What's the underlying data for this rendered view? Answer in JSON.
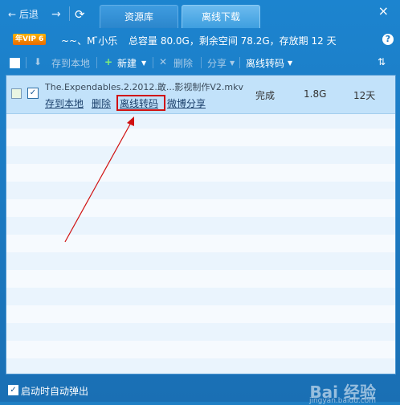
{
  "nav": {
    "back_label": "← 后退",
    "forward_label": "→",
    "refresh_label": "⟳"
  },
  "tabs": [
    {
      "label": "资源库"
    },
    {
      "label": "离线下载"
    }
  ],
  "info": {
    "vip_badge": "年VIP 6",
    "username": "~~、M ̄小乐",
    "storage_text": "总容量 80.0G，剩余空间 78.2G，存放期 12 天"
  },
  "toolbar": {
    "save_local": "存到本地",
    "new": "新建",
    "delete": "删除",
    "share": "分享",
    "transcode": "离线转码"
  },
  "list": {
    "rows": [
      {
        "filename": "The.Expendables.2.2012.敢...影视制作V2.mkv",
        "actions": [
          "存到本地",
          "删除",
          "离线转码",
          "微博分享"
        ],
        "status": "完成",
        "size": "1.8G",
        "days": "12天"
      }
    ]
  },
  "footer": {
    "auto_popup_label": "启动时自动弹出",
    "watermark": "Bai 经验",
    "watermark_sub": "jingyan.baidu.com"
  },
  "colors": {
    "chrome": "#1c84cf",
    "row_selected": "#c2e2fa",
    "highlight": "#d01010"
  }
}
